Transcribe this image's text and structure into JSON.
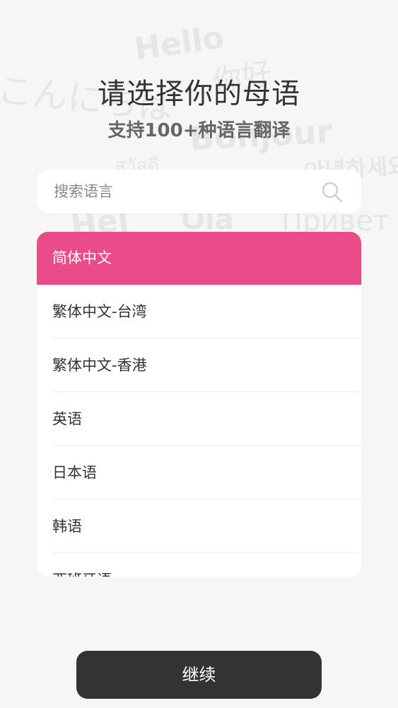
{
  "header": {
    "title": "请选择你的母语",
    "subtitle": "支持100+种语言翻译"
  },
  "background_words": {
    "hello": "Hello",
    "konnichiwa": "こんにちは",
    "nihao": "你好",
    "bonjour": "Bonjour",
    "thai": "สวัสดี",
    "korean": "안녕하세요",
    "hej": "Hej",
    "ola": "Ola",
    "privet": "Привет"
  },
  "search": {
    "placeholder": "搜索语言",
    "icon": "search-icon"
  },
  "languages": [
    {
      "label": "简体中文",
      "selected": true
    },
    {
      "label": "繁体中文-台湾",
      "selected": false
    },
    {
      "label": "繁体中文-香港",
      "selected": false
    },
    {
      "label": "英语",
      "selected": false
    },
    {
      "label": "日本语",
      "selected": false
    },
    {
      "label": "韩语",
      "selected": false
    },
    {
      "label": "西班牙语",
      "selected": false
    }
  ],
  "footer": {
    "continue_label": "继续"
  },
  "colors": {
    "accent": "#e94c88",
    "button": "#333333",
    "background": "#f6f6f6"
  }
}
